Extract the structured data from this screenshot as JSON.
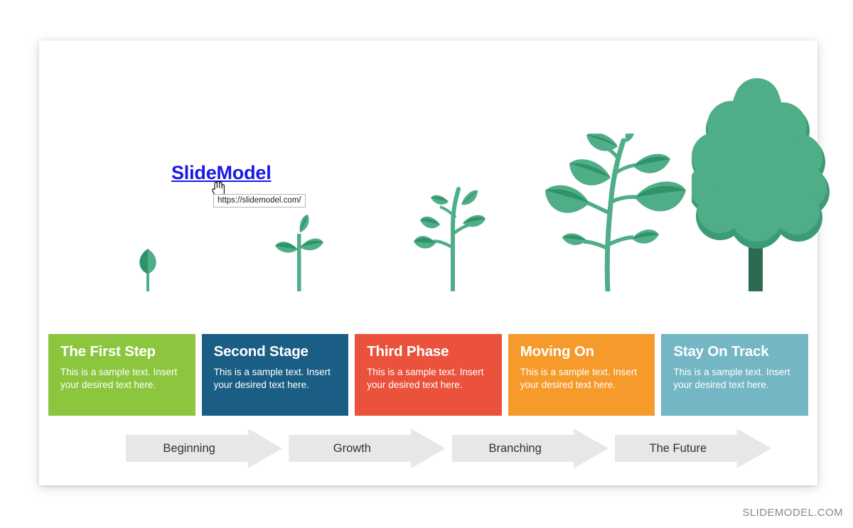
{
  "slide": {
    "link": {
      "label": "SlideModel",
      "tooltip_url": "https://slidemodel.com/",
      "color": "#1a1ae6",
      "cursor_icon": "pointing-hand-cursor"
    },
    "cards": [
      {
        "title": "The First Step",
        "body": "This is a sample text. Insert your desired text here.",
        "color": "#8cc63e",
        "stage_icon": "seedling-single-leaf-icon"
      },
      {
        "title": "Second Stage",
        "body": "This is a sample text. Insert your desired text here.",
        "color": "#1b5e85",
        "stage_icon": "sprout-three-leaf-icon"
      },
      {
        "title": "Third Phase",
        "body": "This is a sample text. Insert your desired text here.",
        "color": "#ea523c",
        "stage_icon": "young-plant-icon"
      },
      {
        "title": "Moving On",
        "body": "This is a sample text. Insert your desired text here.",
        "color": "#f59a2b",
        "stage_icon": "mature-plant-icon"
      },
      {
        "title": "Stay On Track",
        "body": "This is a sample text. Insert your desired text here.",
        "color": "#74b6c4",
        "stage_icon": "tree-icon"
      }
    ],
    "arrows": [
      {
        "label": "Beginning"
      },
      {
        "label": "Growth"
      },
      {
        "label": "Branching"
      },
      {
        "label": "The Future"
      }
    ],
    "plant_colors": {
      "leaf_light": "#4fae88",
      "leaf_dark": "#2f9268",
      "stem": "#4fae88",
      "trunk": "#2c6b52"
    },
    "arrow_color": "#e7e7e7",
    "watermark": "SLIDEMODEL.COM"
  }
}
